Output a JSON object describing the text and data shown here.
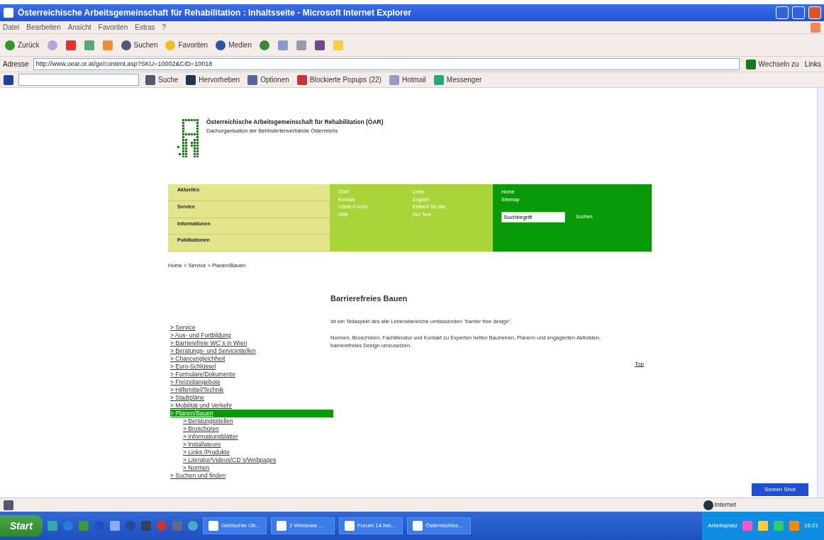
{
  "window": {
    "title": "Österreichische Arbeitsgemeinschaft für Rehabilitation : Inhaltsseite - Microsoft Internet Explorer"
  },
  "menu_bar": [
    "Datei",
    "Bearbeiten",
    "Ansicht",
    "Favoriten",
    "Extras",
    "?"
  ],
  "toolbar": {
    "back_label": "Zurück",
    "search_label": "Suchen",
    "favorites_label": "Favoriten",
    "media_label": "Medien"
  },
  "address_bar": {
    "label": "Adresse",
    "url": "http://www.oear.or.at/ge/content.asp?SKU=10002&CID=10018",
    "go_label": "Wechseln zu",
    "links_label": "Links"
  },
  "msn_bar": {
    "search_label": "Suche",
    "highlight_label": "Hervorheben",
    "options_label": "Optionen",
    "popups_label": "Blockierte Popups (22)",
    "hotmail_label": "Hotmail",
    "messenger_label": "Messenger"
  },
  "page": {
    "org_title": "Österreichische Arbeitsgemeinschaft für Rehabilitation (ÖAR)",
    "org_subtitle": "Dachorganisation der Behindertenverbände Österreichs",
    "main_nav": [
      "Aktuelles",
      "Service",
      "Informationen",
      "Publikationen"
    ],
    "service_links_col1": [
      "ÖAR",
      "Kontakt",
      "Gäste-Forum",
      "Hilfe"
    ],
    "service_links_col2": [
      "Links",
      "English",
      "Einfach für alle",
      "Nur Text"
    ],
    "top_links": [
      "Home",
      "Sitemap"
    ],
    "search": {
      "value": "Suchbegriff",
      "button": "Suchen"
    },
    "breadcrumb": "Home > Service > Planen/Bauen",
    "side_menu": [
      {
        "label": "> Service",
        "selected": false
      },
      {
        "label": "> Aus- und Fortbildung",
        "selected": false
      },
      {
        "label": "> Barrierefreie WC´s in Wien",
        "selected": false
      },
      {
        "label": "> Beratungs- und Servicestellen",
        "selected": false
      },
      {
        "label": "> Chancengleichheit",
        "selected": false
      },
      {
        "label": "> Euro-Schlüssel",
        "selected": false
      },
      {
        "label": "> Formulare/Dokumente",
        "selected": false
      },
      {
        "label": "> Freizeitangebote",
        "selected": false
      },
      {
        "label": "> Hilfsmittel/Technik",
        "selected": false
      },
      {
        "label": "> Stadtpläne",
        "selected": false
      },
      {
        "label": "> Mobilität und Verkehr",
        "selected": false
      },
      {
        "label": "> Planen/Bauen",
        "selected": true,
        "children": [
          {
            "label": "> Beratungsstellen",
            "selected": false
          },
          {
            "label": "> Broschüren",
            "selected": false
          },
          {
            "label": "> Informationsblätter",
            "selected": false
          },
          {
            "label": "> Installateure",
            "selected": false
          },
          {
            "label": "> Links /Produkte",
            "selected": false
          },
          {
            "label": "> Literatur/Videos/CD´s/Webpages",
            "selected": false
          },
          {
            "label": "> Normen",
            "selected": false
          }
        ]
      },
      {
        "label": "> Suchen und finden",
        "selected": false
      }
    ],
    "heading": "Barrierefreies Bauen",
    "paragraphs": [
      "Ist ein Teilaspekt des alle Lebensbereiche umfassenden \"barrier free design\".",
      "Normen, Broschüren, Fachliteratur und Kontakt zu Experten helfen Bauherren, Planern und engagierten Aktivisten, barrierefreies Design umzusetzen."
    ],
    "top_link": "Top"
  },
  "screen_shot_button": "Screen Shot",
  "status_bar": {
    "zone": "Internet"
  },
  "taskbar": {
    "start": "Start",
    "tasks": [
      "Gelöschte Ob...",
      "2 Windows ...",
      "Forum 14 bei...",
      "Österreichisc..."
    ],
    "desktop_label": "Arbeitsplatz",
    "clock": "16:21"
  }
}
